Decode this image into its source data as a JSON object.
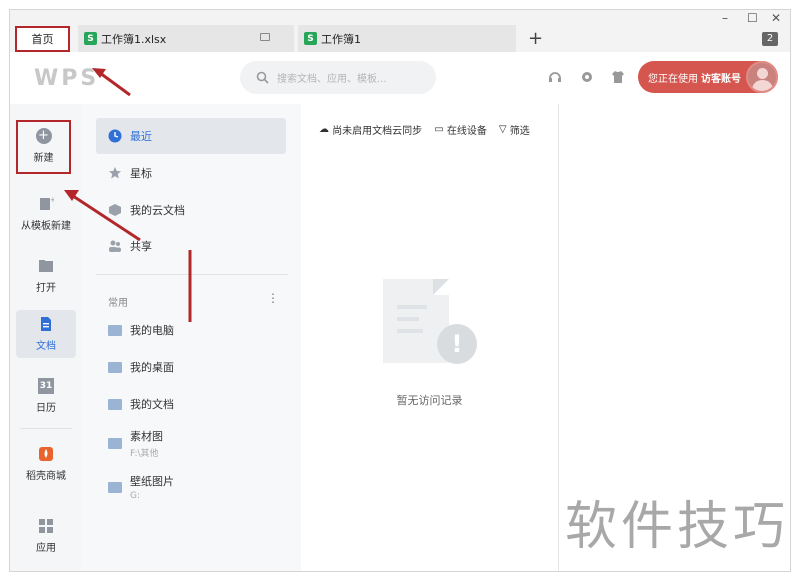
{
  "tabs": {
    "home": "首页",
    "tab1": "工作簿1.xlsx",
    "tab2": "工作簿1",
    "sheet_icon": "S",
    "new_tab": "+",
    "window_count": "2"
  },
  "header": {
    "logo": "WPS",
    "search_placeholder": "搜索文档、应用、模板...",
    "user_status": "您正在使用",
    "user_account": "访客账号"
  },
  "rail": {
    "new": "新建",
    "from_template": "从模板新建",
    "open": "打开",
    "docs": "文档",
    "calendar": "日历",
    "calendar_day": "31",
    "store": "稻壳商城",
    "apps": "应用"
  },
  "nav": {
    "recent": "最近",
    "starred": "星标",
    "cloud": "我的云文档",
    "share": "共享",
    "common_header": "常用",
    "my_computer": "我的电脑",
    "my_desktop": "我的桌面",
    "my_docs": "我的文档",
    "material": "素材图",
    "material_path": "F:\\其他",
    "wallpaper": "壁纸图片",
    "wallpaper_path": "G:"
  },
  "main": {
    "cloud_sync": "尚未启用文档云同步",
    "online_devices": "在线设备",
    "filter": "筛选",
    "empty": "暂无访问记录"
  },
  "watermark": "软件技巧",
  "colors": {
    "accent_red": "#d4564e",
    "annotation_red": "#b3272b",
    "sheet_green": "#27a65a",
    "active_blue": "#2f6fd6"
  }
}
